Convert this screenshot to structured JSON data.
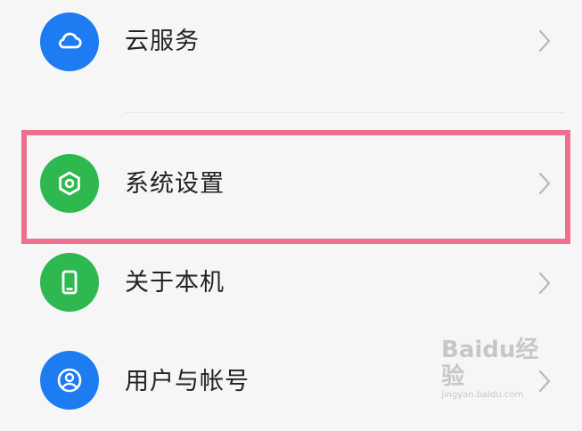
{
  "settings_items": [
    {
      "label": "云服务",
      "icon": "cloud-icon",
      "color": "#1d7cf2"
    },
    {
      "label": "系统设置",
      "icon": "hexagon-settings-icon",
      "color": "#2fb84f"
    },
    {
      "label": "关于本机",
      "icon": "phone-icon",
      "color": "#2fb84f"
    },
    {
      "label": "用户与帐号",
      "icon": "user-account-icon",
      "color": "#1d7cf2"
    }
  ],
  "highlight_color": "#ef6f8e",
  "watermark": {
    "main": "Baidu经验",
    "sub": "jingyan.baidu.com"
  }
}
